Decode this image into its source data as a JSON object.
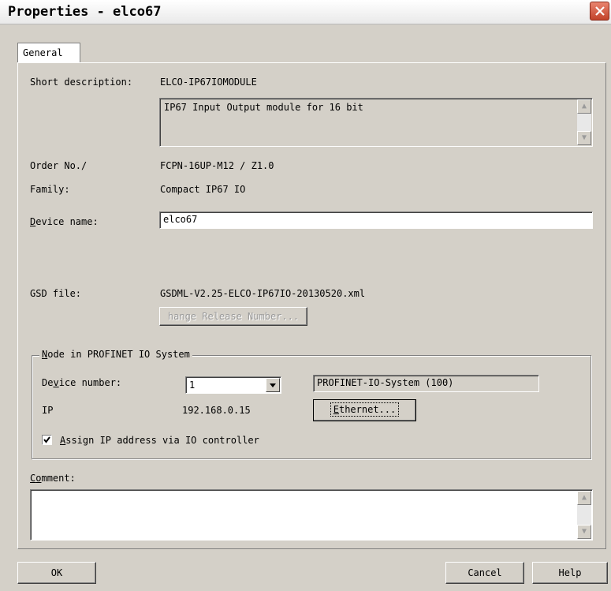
{
  "window": {
    "title": "Properties - elco67",
    "close_glyph": "✕"
  },
  "tabs": [
    {
      "label": "General"
    }
  ],
  "general": {
    "short_description_label": "Short description:",
    "short_description_value": "ELCO-IP67IOMODULE",
    "description_text": "IP67 Input Output module for 16 bit",
    "order_no_label": "Order No./",
    "order_no_value": "FCPN-16UP-M12 / Z1.0",
    "family_label": "Family:",
    "family_value": "Compact IP67 IO",
    "device_name_label_prefix": "D",
    "device_name_label_rest": "evice name:",
    "device_name_value": "elco67",
    "gsd_file_label": "GSD file:",
    "gsd_file_value": "GSDML-V2.25-ELCO-IP67IO-20130520.xml",
    "change_release_button": "hange Release Number..."
  },
  "node": {
    "group_title_prefix": "N",
    "group_title_rest": "ode in PROFINET IO System",
    "device_number_label_prefix": "De",
    "device_number_label_u": "v",
    "device_number_label_rest": "ice number:",
    "device_number_value": "1",
    "io_system_value": "PROFINET-IO-System (100)",
    "ip_label": "IP",
    "ip_value": "192.168.0.15",
    "ethernet_button_prefix": "E",
    "ethernet_button_rest": "thernet...",
    "assign_ip_checked": true,
    "assign_ip_label_prefix": "A",
    "assign_ip_label_rest": "ssign IP address via IO controller"
  },
  "comment": {
    "label_prefix": "C",
    "label_u": "o",
    "label_rest": "mment:",
    "value": ""
  },
  "footer": {
    "ok_label": "OK",
    "cancel_label": "Cancel",
    "help_label": "Help"
  },
  "colors": {
    "dialog_bg": "#d4d0c8",
    "close_button": "#c2432a"
  },
  "icons": {
    "close": "close-icon",
    "scroll_up": "scroll-up-arrow-icon",
    "scroll_down": "scroll-down-arrow-icon",
    "combo_arrow": "chevron-down-icon",
    "checkbox": "checkmark-icon"
  }
}
